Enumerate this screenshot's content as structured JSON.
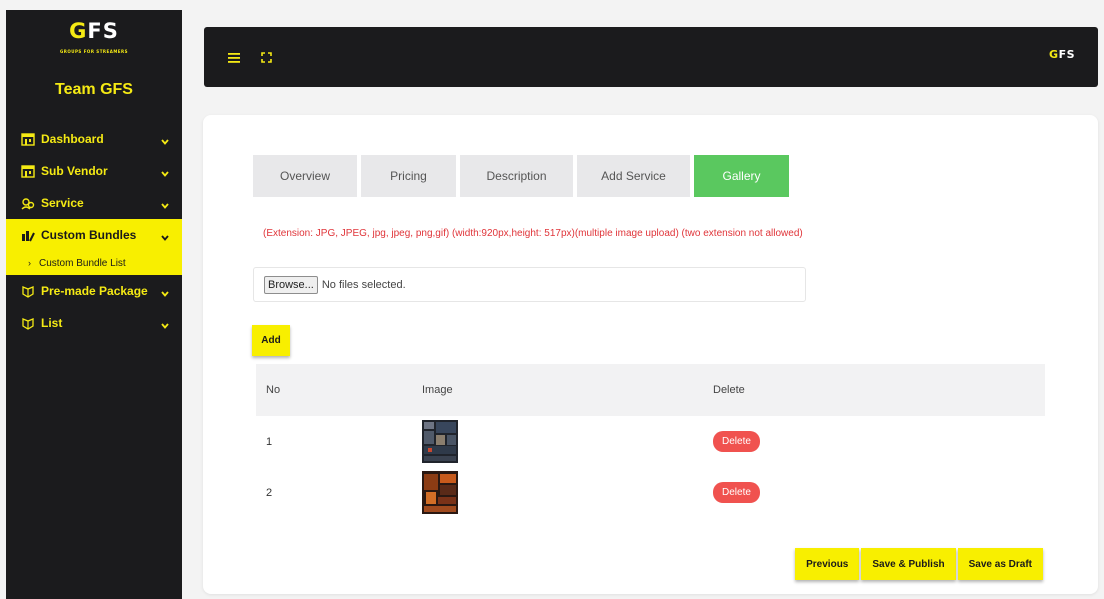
{
  "brand": {
    "logo_text": "GFS",
    "logo_tagline": "GROUPS FOR STREAMERS",
    "team_name": "Team GFS"
  },
  "sidebar": {
    "items": [
      {
        "label": "Dashboard",
        "icon": "store-icon"
      },
      {
        "label": "Sub Vendor",
        "icon": "store-icon"
      },
      {
        "label": "Service",
        "icon": "gear-people-icon"
      },
      {
        "label": "Custom Bundles",
        "icon": "bundle-icon",
        "active": true
      },
      {
        "label": "Pre-made Package",
        "icon": "package-icon"
      },
      {
        "label": "List",
        "icon": "package-icon"
      }
    ],
    "sub_items": [
      {
        "label": "Custom Bundle List"
      }
    ]
  },
  "topbar": {
    "menu_icon": "hamburger-icon",
    "fullscreen_icon": "expand-icon",
    "logo_text": "GFS"
  },
  "tabs": [
    {
      "label": "Overview"
    },
    {
      "label": "Pricing"
    },
    {
      "label": "Description"
    },
    {
      "label": "Add Service"
    },
    {
      "label": "Gallery",
      "active": true
    }
  ],
  "gallery": {
    "extension_note": "(Extension: JPG, JPEG, jpg, jpeg, png,gif) (width:920px,height: 517px)(multiple image upload) (two extension not allowed)",
    "browse_label": "Browse...",
    "no_file_text": "No files selected.",
    "add_label": "Add",
    "table": {
      "headers": {
        "no": "No",
        "image": "Image",
        "delete": "Delete"
      },
      "rows": [
        {
          "no": "1",
          "delete_label": "Delete"
        },
        {
          "no": "2",
          "delete_label": "Delete"
        }
      ]
    }
  },
  "actions": {
    "previous": "Previous",
    "save_publish": "Save & Publish",
    "save_draft": "Save as Draft"
  },
  "colors": {
    "accent_yellow": "#f8ef00",
    "active_tab_green": "#5ac85f",
    "delete_red": "#f0524f",
    "dark": "#1b1b1d",
    "note_red": "#e0353a"
  }
}
